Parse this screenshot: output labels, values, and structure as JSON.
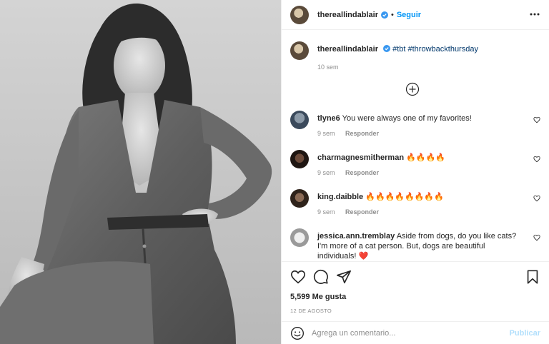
{
  "header": {
    "username": "thereallindablair",
    "separator": "•",
    "follow_label": "Seguir"
  },
  "caption": {
    "username": "thereallindablair",
    "tags": "#tbt #throwbackthursday",
    "time": "10 sem"
  },
  "comments": [
    {
      "user": "tlyne6",
      "text": "You were always one of my favorites!",
      "time": "9 sem",
      "reply": "Responder",
      "avatar_color": "#3b4a5c"
    },
    {
      "user": "charmagnesmitherman",
      "text": "🔥🔥🔥🔥",
      "time": "9 sem",
      "reply": "Responder",
      "avatar_color": "#2a1f1a"
    },
    {
      "user": "king.daibble",
      "text": "🔥🔥🔥🔥🔥🔥🔥🔥",
      "time": "9 sem",
      "reply": "Responder",
      "avatar_color": "#3a2b20"
    },
    {
      "user": "jessica.ann.tremblay",
      "text": "Aside from dogs, do you like cats? I'm more of a cat person. But, dogs are beautiful individuals! ❤️",
      "time": "9 sem",
      "reply": "Responder",
      "avatar_color": "#d9d9d9"
    }
  ],
  "likes": "5,599 Me gusta",
  "date": "12 DE AGOSTO",
  "composer": {
    "placeholder": "Agrega un comentario...",
    "post_label": "Publicar"
  },
  "icons": {
    "verified": "verified-badge-icon",
    "more": "more-options-icon",
    "load_more": "load-more-comments-icon",
    "like": "heart-icon",
    "comment": "comment-icon",
    "share": "share-icon",
    "save": "bookmark-icon",
    "emoji": "emoji-icon"
  },
  "colors": {
    "link": "#0095f6",
    "hashtag": "#00376b",
    "muted": "#8e8e8e",
    "post_disabled": "#b2dffc"
  }
}
